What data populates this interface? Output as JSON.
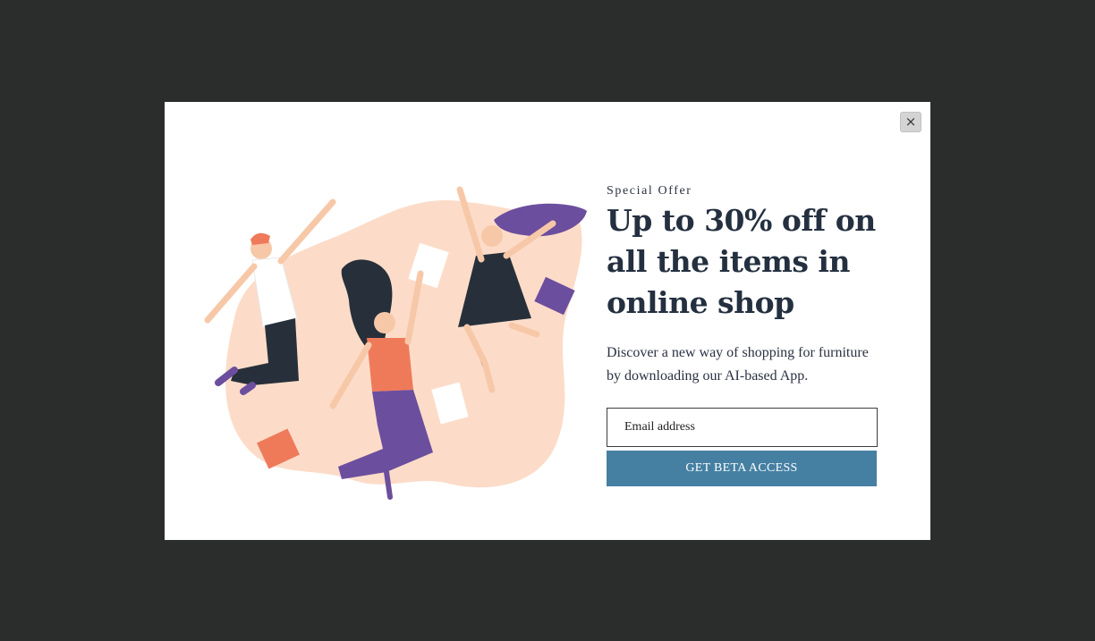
{
  "modal": {
    "close_label": "×",
    "eyebrow": "Special Offer",
    "headline": "Up to 30% off on all the items in online shop",
    "description": "Discover a new way of shopping for furniture by downloading our AI-based App.",
    "email_placeholder": "Email address",
    "cta_label": "GET BETA ACCESS"
  },
  "illustration": {
    "icon": "jumping-people-illustration"
  },
  "colors": {
    "backdrop": "#2b2c2c",
    "modal_bg": "#ffffff",
    "blob": "#fcdcc8",
    "accent_button": "#4580a3",
    "headline": "#243040",
    "purple": "#6c4e9e",
    "coral": "#ef7a5a"
  }
}
